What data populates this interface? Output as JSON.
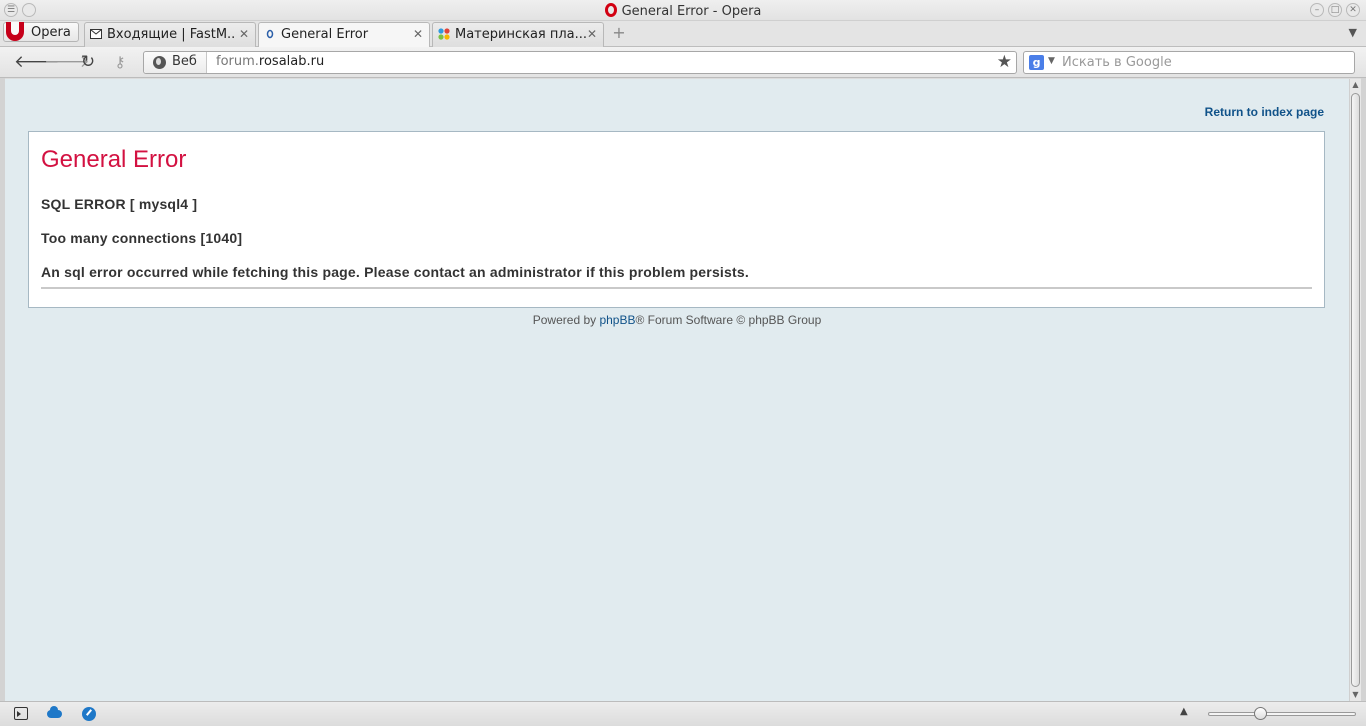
{
  "window": {
    "title": "General Error - Opera"
  },
  "menu": {
    "label": "Opera"
  },
  "tabs": [
    {
      "label": "Входящие | FastM...",
      "close": "✕"
    },
    {
      "label": "General Error",
      "close": "✕"
    },
    {
      "label": "Материнская пла...",
      "close": "✕"
    }
  ],
  "nav": {
    "badge_label": "Веб",
    "url_prefix": "forum.",
    "url_domain": "rosalab.ru"
  },
  "search": {
    "placeholder": "Искать в Google",
    "engine_letter": "g"
  },
  "page": {
    "return_link": "Return to index page",
    "heading": "General Error",
    "sql_error": "SQL ERROR [ mysql4 ]",
    "error_detail": "Too many connections [1040]",
    "message": "An sql error occurred while fetching this page. Please contact an administrator if this problem persists.",
    "footer_prefix": "Powered by ",
    "footer_link": "phpBB",
    "footer_suffix": "® Forum Software © phpBB Group"
  },
  "colors": {
    "heading": "#d31141",
    "link": "#105289",
    "page_bg": "#e1ebef",
    "opera_red": "#c6001a"
  },
  "icons": [
    "back-icon",
    "forward-icon",
    "reload-icon",
    "key-icon",
    "globe-icon",
    "star-icon",
    "google-icon",
    "panel-toggle-icon",
    "cloud-icon",
    "speed-dial-icon"
  ]
}
